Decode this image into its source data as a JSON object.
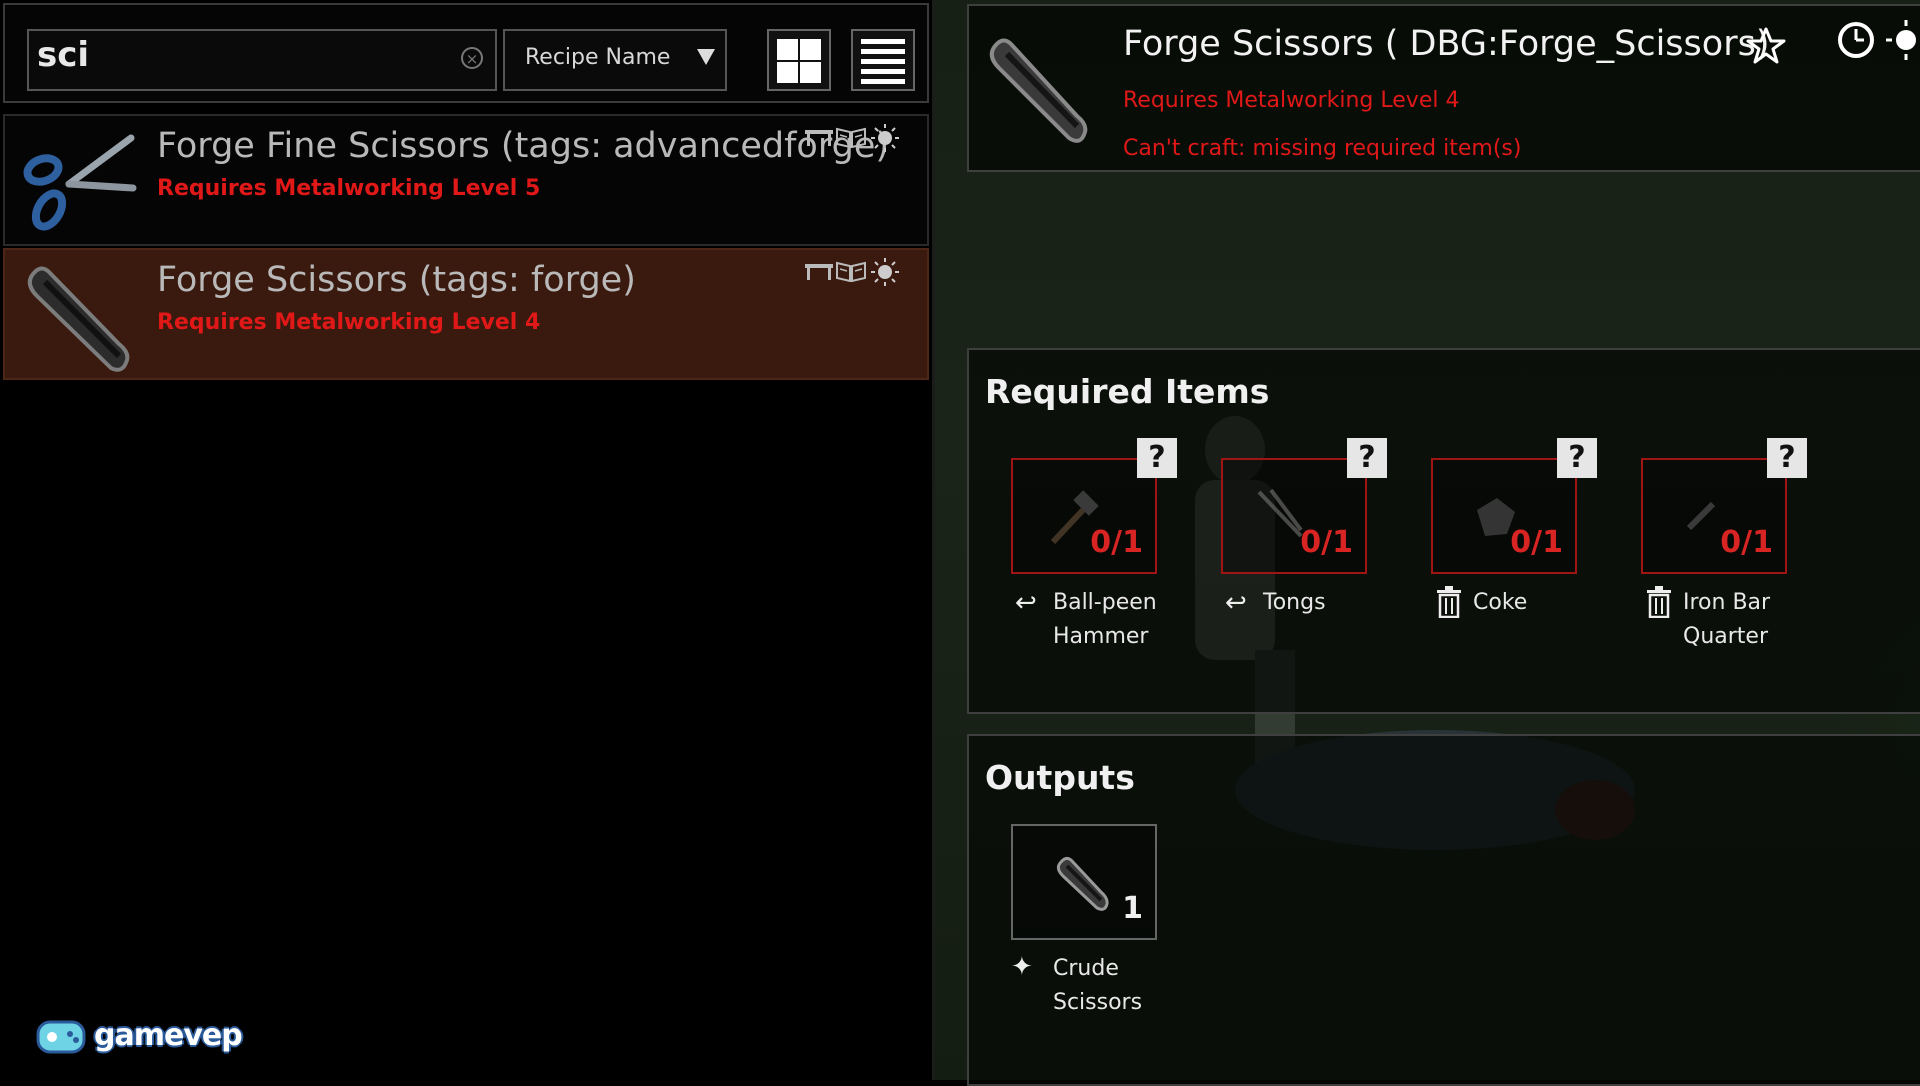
{
  "search": {
    "value": "sci",
    "clear_icon": "close-icon"
  },
  "sort": {
    "label": "Recipe Name",
    "icon": "chevron-down-icon"
  },
  "view_toggle": {
    "grid_icon": "grid-icon",
    "list_icon": "list-icon"
  },
  "recipes": [
    {
      "name": "Forge Fine Scissors (tags: advancedforge)",
      "requirement": "Requires Metalworking Level 5",
      "icon": "scissors-icon",
      "selected": false,
      "status_icons": [
        "workbench-icon",
        "book-icon",
        "sun-icon"
      ]
    },
    {
      "name": "Forge Scissors (tags: forge)",
      "requirement": "Requires Metalworking Level 4",
      "icon": "crude-scissors-icon",
      "selected": true,
      "status_icons": [
        "workbench-icon",
        "book-icon",
        "sun-icon"
      ]
    }
  ],
  "detail": {
    "title": "Forge Scissors ( DBG:Forge_Scissors)",
    "requirement": "Requires Metalworking Level 4",
    "error": "Can't craft: missing required item(s)",
    "icons": [
      "crude-scissors-icon",
      "star-icon",
      "clock-icon",
      "sun-icon"
    ]
  },
  "required": {
    "title": "Required Items",
    "items": [
      {
        "label_line1": "Ball-peen",
        "label_line2": "Hammer",
        "count": "0/1",
        "badge": "?",
        "type_icon": "return-icon",
        "item_icon": "hammer-icon"
      },
      {
        "label_line1": "Tongs",
        "label_line2": "",
        "count": "0/1",
        "badge": "?",
        "type_icon": "return-icon",
        "item_icon": "tongs-icon"
      },
      {
        "label_line1": "Coke",
        "label_line2": "",
        "count": "0/1",
        "badge": "?",
        "type_icon": "trash-icon",
        "item_icon": "coke-icon"
      },
      {
        "label_line1": "Iron Bar",
        "label_line2": "Quarter",
        "count": "0/1",
        "badge": "?",
        "type_icon": "trash-icon",
        "item_icon": "iron-bar-icon"
      }
    ]
  },
  "outputs": {
    "title": "Outputs",
    "items": [
      {
        "label_line1": "Crude",
        "label_line2": "Scissors",
        "count": "1",
        "type_icon": "sparkle-icon",
        "item_icon": "crude-scissors-icon"
      }
    ]
  },
  "watermark": {
    "text": "gamevep",
    "icon": "gamepad-logo-icon"
  },
  "colors": {
    "error_red": "#e01818",
    "selected_row": "#3a1a0e",
    "slot_border_missing": "#a01414"
  }
}
